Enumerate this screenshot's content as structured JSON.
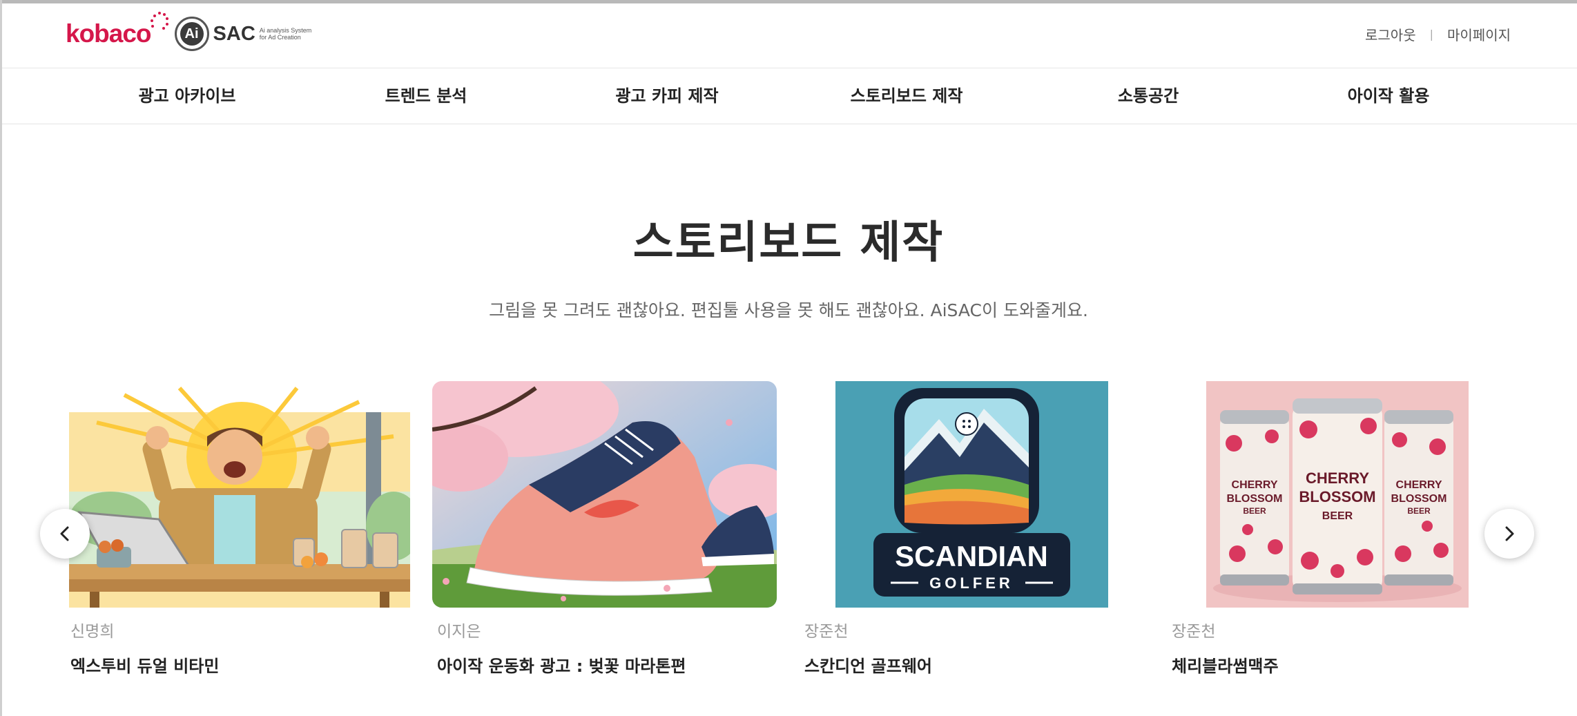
{
  "header": {
    "brand": "kobaco",
    "ai_badge": "Ai",
    "product": "SAC",
    "product_sub_line1": "Ai analysis System",
    "product_sub_line2": "for Ad Creation",
    "logout": "로그아웃",
    "separator": "|",
    "mypage": "마이페이지"
  },
  "nav": {
    "items": [
      {
        "label": "광고 아카이브"
      },
      {
        "label": "트렌드 분석"
      },
      {
        "label": "광고 카피 제작"
      },
      {
        "label": "스토리보드 제작"
      },
      {
        "label": "소통공간"
      },
      {
        "label": "아이작 활용"
      }
    ]
  },
  "main": {
    "title": "스토리보드 제작",
    "subtitle": "그림을 못 그려도 괜찮아요. 편집툴 사용을 못 해도 괜찮아요. AiSAC이 도와줄게요."
  },
  "cards": [
    {
      "author": "신명희",
      "title": "엑스투비 듀얼 비타민"
    },
    {
      "author": "이지은",
      "title": "아이작 운동화 광고 : 벚꽃 마라톤편"
    },
    {
      "author": "장준천",
      "title": "스칸디언 골프웨어",
      "logo_line1": "SCANDIAN",
      "logo_line2": "GOLFER"
    },
    {
      "author": "장준천",
      "title": "체리블라썸맥주",
      "can_line1": "CHERRY",
      "can_line2": "BLOSSOM",
      "can_line3": "BEER"
    }
  ],
  "carousel": {
    "prev_icon": "chevron-left-icon",
    "next_icon": "chevron-right-icon"
  },
  "colors": {
    "brand": "#d5174a",
    "text": "#222222",
    "muted": "#9a9a9a"
  }
}
